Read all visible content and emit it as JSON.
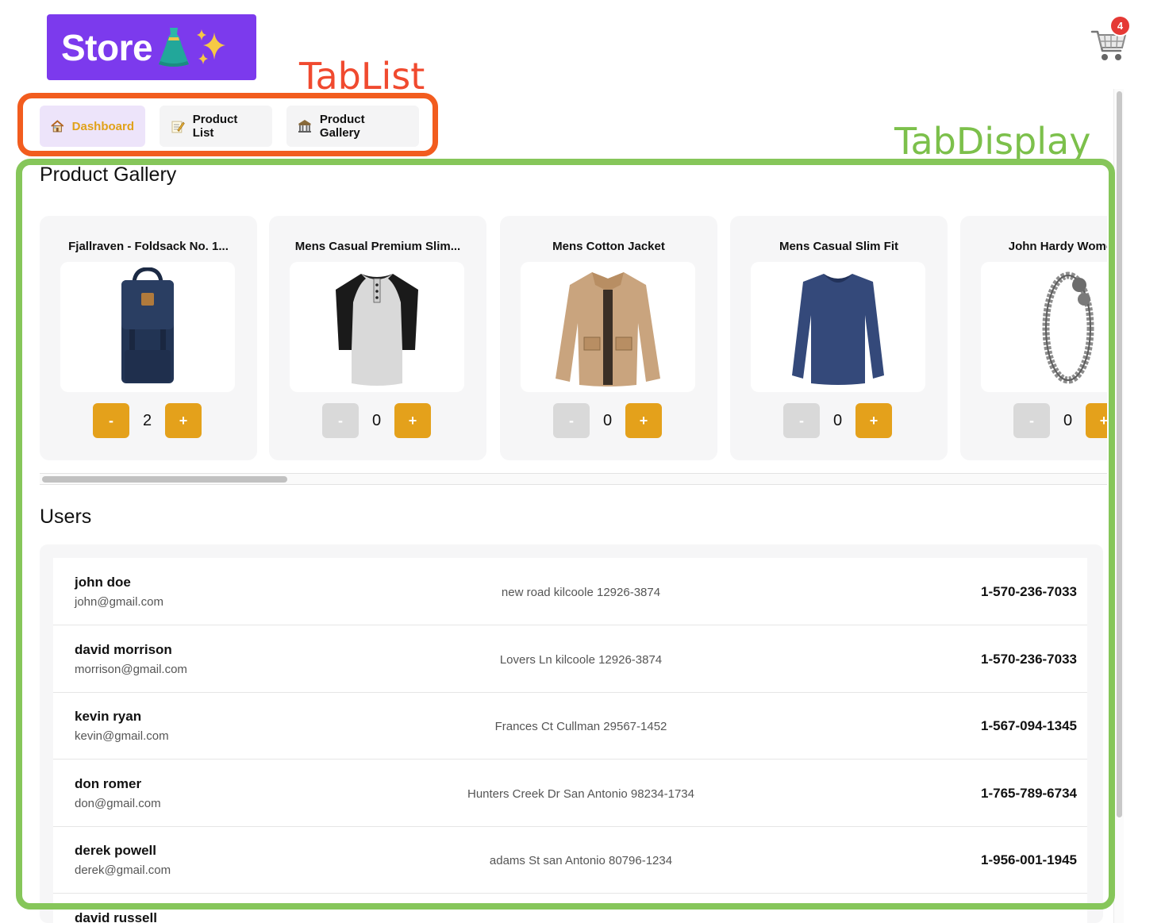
{
  "app": {
    "logo_text": "Store",
    "cart_count": "4",
    "icons": {
      "logo_dress": "dress-icon",
      "logo_sparkle": "sparkles-icon",
      "cart": "shopping-cart-icon"
    }
  },
  "annotations": {
    "tablist_label": "TabList",
    "tabdisplay_label": "TabDisplay",
    "tablist_color": "#f04a2f",
    "tabdisplay_color": "#7cc04b"
  },
  "tabs": [
    {
      "label": "Dashboard",
      "icon": "house-icon",
      "active": true
    },
    {
      "label": "Product List",
      "icon": "memo-icon",
      "active": false
    },
    {
      "label": "Product Gallery",
      "icon": "classical-building-icon",
      "active": false
    }
  ],
  "gallery": {
    "title": "Product Gallery",
    "products": [
      {
        "title": "Fjallraven - Foldsack No. 1...",
        "qty": "2",
        "minus_label": "-",
        "plus_label": "+",
        "minus_enabled": true,
        "image": "backpack-image"
      },
      {
        "title": "Mens Casual Premium Slim...",
        "qty": "0",
        "minus_label": "-",
        "plus_label": "+",
        "minus_enabled": false,
        "image": "raglan-tshirt-image"
      },
      {
        "title": "Mens Cotton Jacket",
        "qty": "0",
        "minus_label": "-",
        "plus_label": "+",
        "minus_enabled": false,
        "image": "cotton-jacket-image"
      },
      {
        "title": "Mens Casual Slim Fit",
        "qty": "0",
        "minus_label": "-",
        "plus_label": "+",
        "minus_enabled": false,
        "image": "longsleeve-shirt-image"
      },
      {
        "title": "John Hardy Women's",
        "qty": "0",
        "minus_label": "-",
        "plus_label": "+",
        "minus_enabled": false,
        "image": "bracelet-image"
      }
    ]
  },
  "users": {
    "title": "Users",
    "list": [
      {
        "name": "john doe",
        "email": "john@gmail.com",
        "address": "new road kilcoole 12926-3874",
        "phone": "1-570-236-7033"
      },
      {
        "name": "david morrison",
        "email": "morrison@gmail.com",
        "address": "Lovers Ln kilcoole 12926-3874",
        "phone": "1-570-236-7033"
      },
      {
        "name": "kevin ryan",
        "email": "kevin@gmail.com",
        "address": "Frances Ct Cullman 29567-1452",
        "phone": "1-567-094-1345"
      },
      {
        "name": "don romer",
        "email": "don@gmail.com",
        "address": "Hunters Creek Dr San Antonio 98234-1734",
        "phone": "1-765-789-6734"
      },
      {
        "name": "derek powell",
        "email": "derek@gmail.com",
        "address": "adams St san Antonio 80796-1234",
        "phone": "1-956-001-1945"
      },
      {
        "name": "david russell",
        "email": "",
        "address": "",
        "phone": ""
      }
    ]
  },
  "colors": {
    "brand": "#7c3aed",
    "accent": "#e4a11b",
    "active_tab_bg": "#ede4fa",
    "badge": "#e53935",
    "disabled": "#d9d9d9"
  }
}
